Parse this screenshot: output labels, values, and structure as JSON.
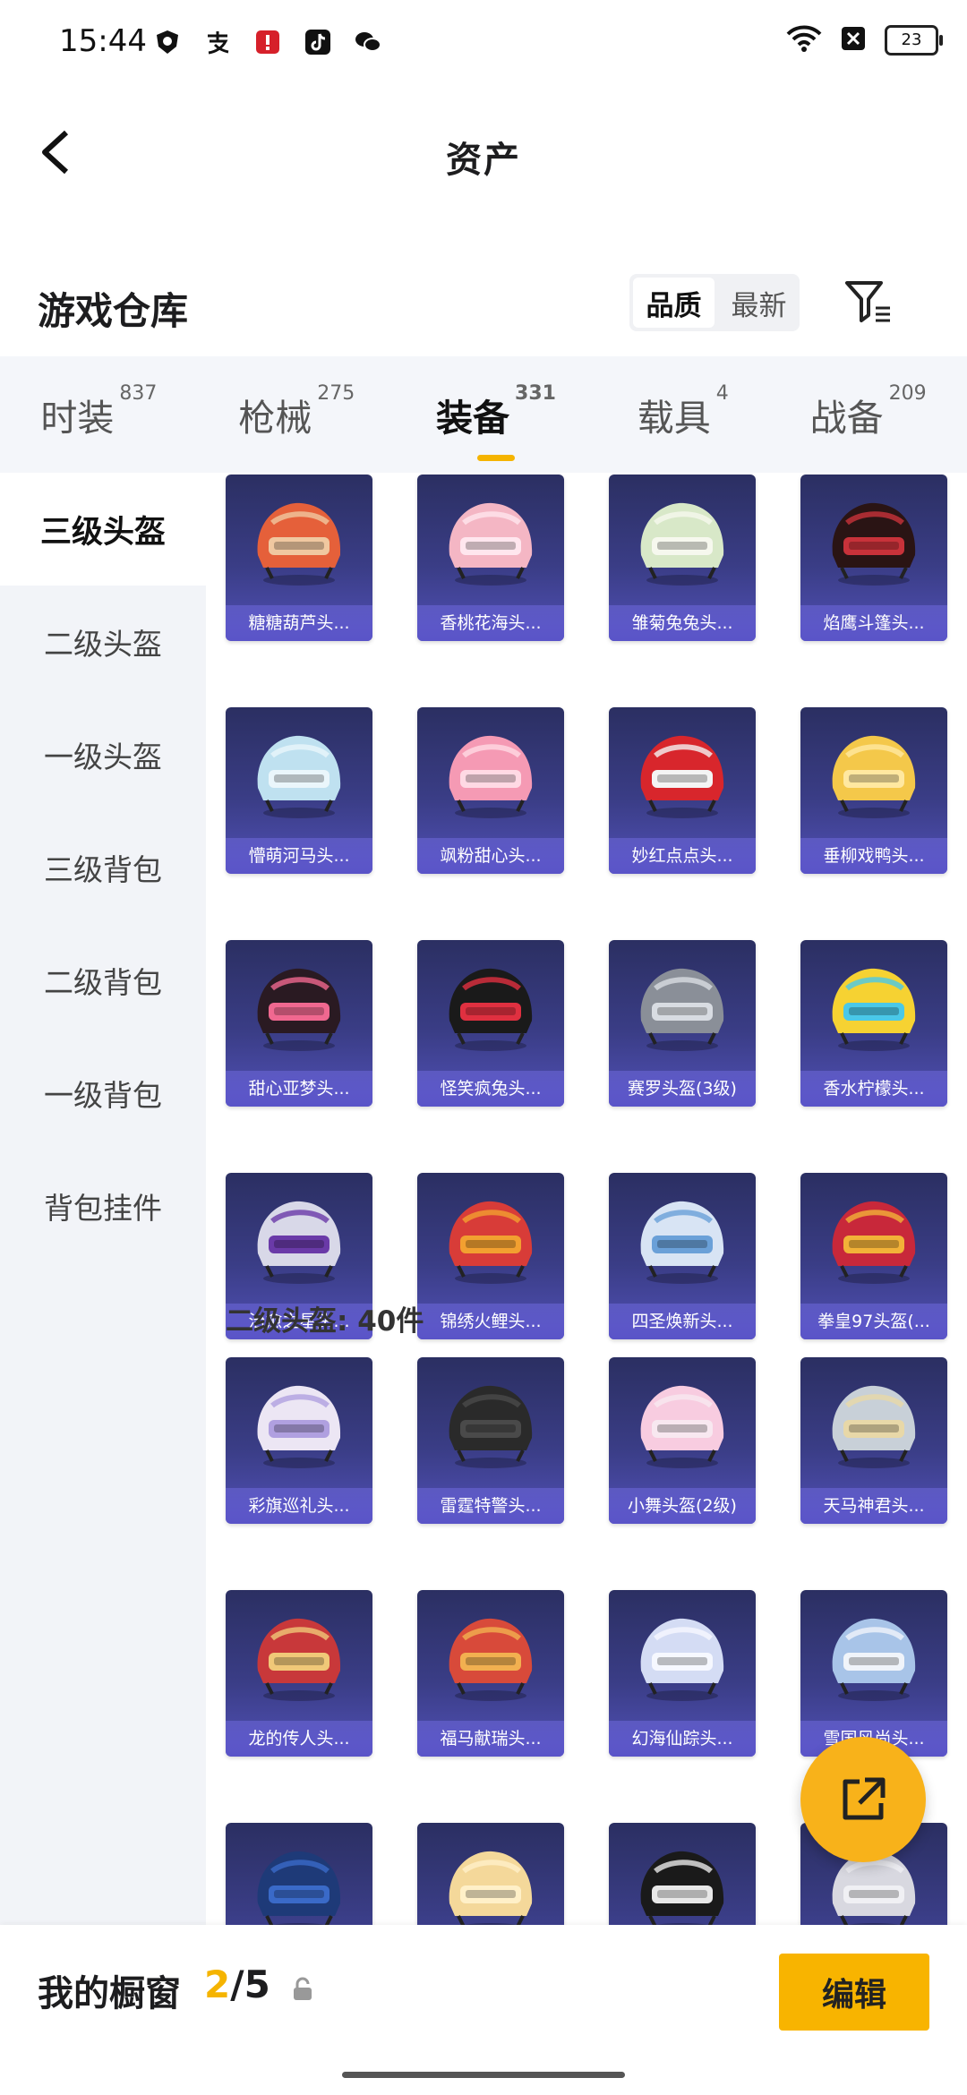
{
  "status": {
    "time": "15:44",
    "battery": "23"
  },
  "header": {
    "title": "资产"
  },
  "warehouse": {
    "title": "游戏仓库",
    "sort_options": [
      "品质",
      "最新"
    ]
  },
  "tabs": [
    {
      "label": "时装",
      "count": "837"
    },
    {
      "label": "枪械",
      "count": "275"
    },
    {
      "label": "装备",
      "count": "331"
    },
    {
      "label": "载具",
      "count": "4"
    },
    {
      "label": "战备",
      "count": "209"
    }
  ],
  "sidebar": [
    "三级头盔",
    "二级头盔",
    "一级头盔",
    "三级背包",
    "二级背包",
    "一级背包",
    "背包挂件"
  ],
  "groups": [
    {
      "label": "",
      "items": [
        "糖糖葫芦头...",
        "香桃花海头...",
        "雏菊兔兔头...",
        "焰鹰斗篷头...",
        "懵萌河马头...",
        "飒粉甜心头...",
        "妙红点点头...",
        "垂柳戏鸭头...",
        "甜心亚梦头...",
        "怪笑疯兔头...",
        "赛罗头盔(3级)",
        "香水柠檬头...",
        "治愈之星头...",
        "锦绣火鲤头...",
        "四圣焕新头...",
        "拳皇97头盔(..."
      ]
    },
    {
      "label": "二级头盔: 40件",
      "items": [
        "彩旗巡礼头...",
        "雷霆特警头...",
        "小舞头盔(2级)",
        "天马神君头...",
        "龙的传人头...",
        "福马献瑞头...",
        "幻海仙踪头...",
        "雪国风尚头...",
        "",
        "",
        "",
        ""
      ]
    }
  ],
  "bottom": {
    "showcase_label": "我的橱窗",
    "showcase_current": "2",
    "showcase_total": "/5",
    "edit_label": "编辑"
  },
  "colors": {
    "accent": "#f5b400",
    "card": "#3a3d86"
  }
}
